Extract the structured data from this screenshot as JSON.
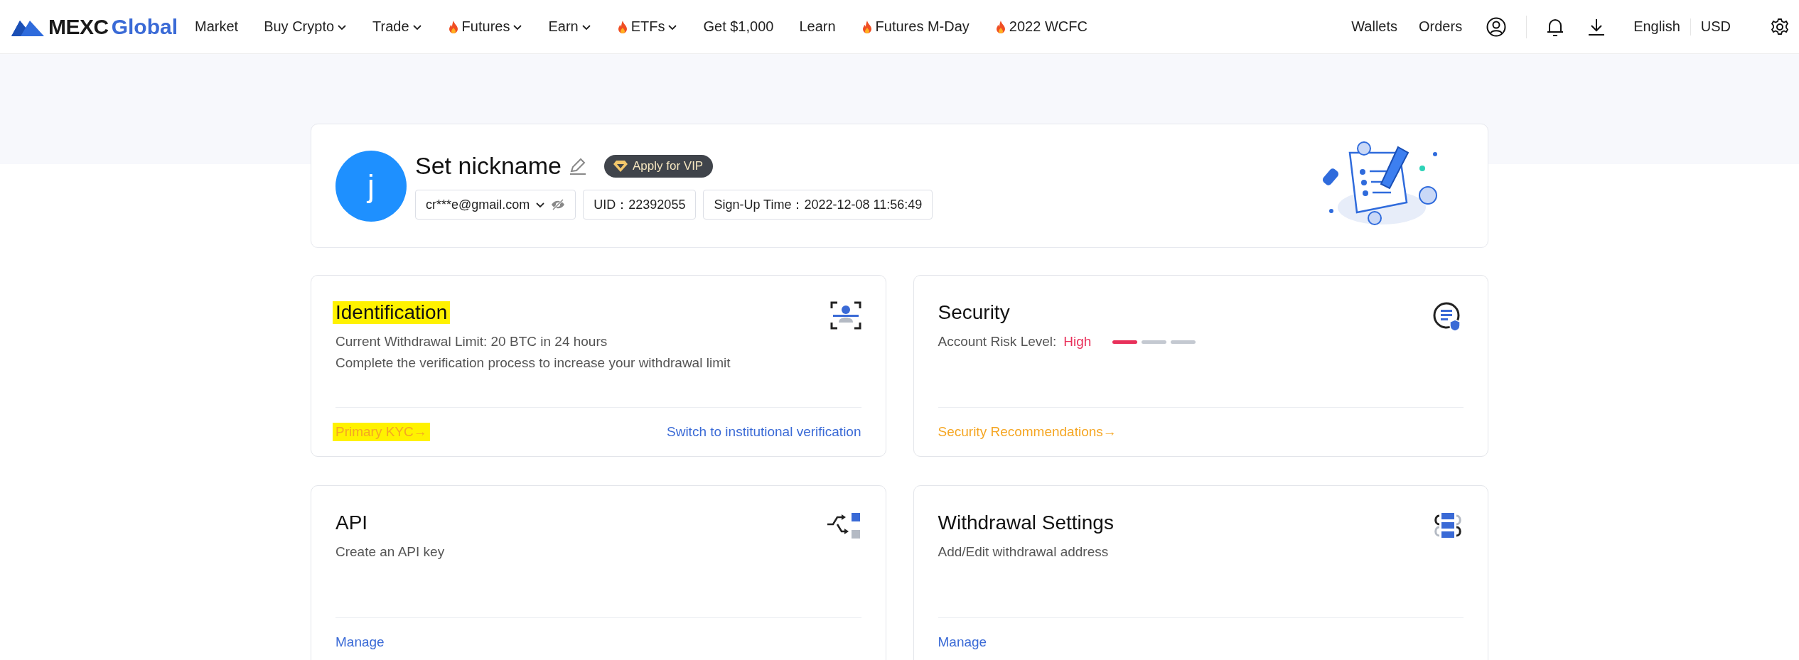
{
  "nav": {
    "logo": {
      "brand": "MEXC",
      "suffix": "Global"
    },
    "items": [
      {
        "label": "Market",
        "hot": false,
        "dropdown": false
      },
      {
        "label": "Buy Crypto",
        "hot": false,
        "dropdown": true
      },
      {
        "label": "Trade",
        "hot": false,
        "dropdown": true
      },
      {
        "label": "Futures",
        "hot": true,
        "dropdown": true
      },
      {
        "label": "Earn",
        "hot": false,
        "dropdown": true
      },
      {
        "label": "ETFs",
        "hot": true,
        "dropdown": true
      },
      {
        "label": "Get $1,000",
        "hot": false,
        "dropdown": false
      },
      {
        "label": "Learn",
        "hot": false,
        "dropdown": false
      },
      {
        "label": "Futures M-Day",
        "hot": true,
        "dropdown": false
      },
      {
        "label": "2022 WCFC",
        "hot": true,
        "dropdown": false
      }
    ],
    "right_links": [
      "Wallets",
      "Orders"
    ],
    "language": "English",
    "currency": "USD"
  },
  "profile": {
    "avatar_letter": "j",
    "nickname": "Set nickname",
    "vip_button": "Apply for VIP",
    "email": "cr***e@gmail.com",
    "uid": "UID：22392055",
    "signup": "Sign-Up Time：2022-12-08 11:56:49"
  },
  "cards": [
    {
      "kind": "identification",
      "title": "Identification",
      "title_highlighted": true,
      "lines": [
        "Current Withdrawal Limit: 20 BTC in 24 hours",
        "Complete the verification process to increase your withdrawal limit"
      ],
      "actions": [
        {
          "label": "Primary KYC→",
          "kind": "warning",
          "highlighted": true
        },
        {
          "label": "Switch to institutional verification",
          "kind": "link",
          "highlighted": false
        }
      ]
    },
    {
      "kind": "security",
      "title": "Security",
      "title_highlighted": false,
      "risk": {
        "label": "Account Risk Level:",
        "value": "High",
        "level": 0.33
      },
      "actions": [
        {
          "label": "Security Recommendations→",
          "kind": "warning",
          "highlighted": false
        }
      ]
    },
    {
      "kind": "api",
      "title": "API",
      "title_highlighted": false,
      "lines": [
        "Create an API key"
      ],
      "actions": [
        {
          "label": "Manage",
          "kind": "link",
          "highlighted": false
        }
      ]
    },
    {
      "kind": "withdrawal",
      "title": "Withdrawal Settings",
      "title_highlighted": false,
      "lines": [
        "Add/Edit withdrawal address"
      ],
      "actions": [
        {
          "label": "Manage",
          "kind": "link",
          "highlighted": false
        }
      ]
    }
  ]
}
